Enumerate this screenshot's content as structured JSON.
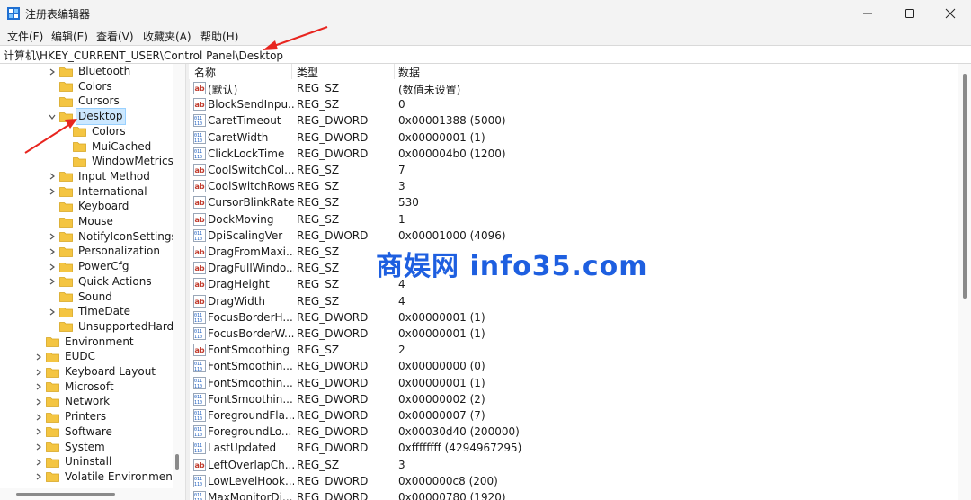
{
  "window": {
    "title": "注册表编辑器",
    "icons": {
      "app": "registry-editor-icon",
      "minimize": "minimize-icon",
      "maximize": "maximize-icon",
      "close": "close-icon"
    }
  },
  "menu": [
    "文件(F)",
    "编辑(E)",
    "查看(V)",
    "收藏夹(A)",
    "帮助(H)"
  ],
  "address": "计算机\\HKEY_CURRENT_USER\\Control Panel\\Desktop",
  "tree": [
    {
      "label": "Bluetooth",
      "level": 2,
      "chevron": "collapsed"
    },
    {
      "label": "Colors",
      "level": 2,
      "chevron": "none"
    },
    {
      "label": "Cursors",
      "level": 2,
      "chevron": "none"
    },
    {
      "label": "Desktop",
      "level": 2,
      "chevron": "expanded",
      "selected": true
    },
    {
      "label": "Colors",
      "level": 3,
      "chevron": "none"
    },
    {
      "label": "MuiCached",
      "level": 3,
      "chevron": "none"
    },
    {
      "label": "WindowMetrics",
      "level": 3,
      "chevron": "none"
    },
    {
      "label": "Input Method",
      "level": 2,
      "chevron": "collapsed"
    },
    {
      "label": "International",
      "level": 2,
      "chevron": "collapsed"
    },
    {
      "label": "Keyboard",
      "level": 2,
      "chevron": "none"
    },
    {
      "label": "Mouse",
      "level": 2,
      "chevron": "none"
    },
    {
      "label": "NotifyIconSettings",
      "level": 2,
      "chevron": "collapsed"
    },
    {
      "label": "Personalization",
      "level": 2,
      "chevron": "collapsed"
    },
    {
      "label": "PowerCfg",
      "level": 2,
      "chevron": "collapsed"
    },
    {
      "label": "Quick Actions",
      "level": 2,
      "chevron": "collapsed"
    },
    {
      "label": "Sound",
      "level": 2,
      "chevron": "none"
    },
    {
      "label": "TimeDate",
      "level": 2,
      "chevron": "collapsed"
    },
    {
      "label": "UnsupportedHardv",
      "level": 2,
      "chevron": "none"
    },
    {
      "label": "Environment",
      "level": 1,
      "chevron": "none"
    },
    {
      "label": "EUDC",
      "level": 1,
      "chevron": "collapsed"
    },
    {
      "label": "Keyboard Layout",
      "level": 1,
      "chevron": "collapsed"
    },
    {
      "label": "Microsoft",
      "level": 1,
      "chevron": "collapsed"
    },
    {
      "label": "Network",
      "level": 1,
      "chevron": "collapsed"
    },
    {
      "label": "Printers",
      "level": 1,
      "chevron": "collapsed"
    },
    {
      "label": "Software",
      "level": 1,
      "chevron": "collapsed"
    },
    {
      "label": "System",
      "level": 1,
      "chevron": "collapsed"
    },
    {
      "label": "Uninstall",
      "level": 1,
      "chevron": "collapsed"
    },
    {
      "label": "Volatile Environment",
      "level": 1,
      "chevron": "collapsed"
    }
  ],
  "list": {
    "headers": {
      "name": "名称",
      "type": "类型",
      "data": "数据"
    },
    "rows": [
      {
        "name": "(默认)",
        "type": "REG_SZ",
        "data": "(数值未设置)",
        "icon": "string-value-icon"
      },
      {
        "name": "BlockSendInpu...",
        "type": "REG_SZ",
        "data": "0",
        "icon": "string-value-icon"
      },
      {
        "name": "CaretTimeout",
        "type": "REG_DWORD",
        "data": "0x00001388 (5000)",
        "icon": "binary-value-icon"
      },
      {
        "name": "CaretWidth",
        "type": "REG_DWORD",
        "data": "0x00000001 (1)",
        "icon": "binary-value-icon"
      },
      {
        "name": "ClickLockTime",
        "type": "REG_DWORD",
        "data": "0x000004b0 (1200)",
        "icon": "binary-value-icon"
      },
      {
        "name": "CoolSwitchCol...",
        "type": "REG_SZ",
        "data": "7",
        "icon": "string-value-icon"
      },
      {
        "name": "CoolSwitchRows",
        "type": "REG_SZ",
        "data": "3",
        "icon": "string-value-icon"
      },
      {
        "name": "CursorBlinkRate",
        "type": "REG_SZ",
        "data": "530",
        "icon": "string-value-icon"
      },
      {
        "name": "DockMoving",
        "type": "REG_SZ",
        "data": "1",
        "icon": "string-value-icon"
      },
      {
        "name": "DpiScalingVer",
        "type": "REG_DWORD",
        "data": "0x00001000 (4096)",
        "icon": "binary-value-icon"
      },
      {
        "name": "DragFromMaxi...",
        "type": "REG_SZ",
        "data": "",
        "icon": "string-value-icon"
      },
      {
        "name": "DragFullWindo...",
        "type": "REG_SZ",
        "data": "",
        "icon": "string-value-icon"
      },
      {
        "name": "DragHeight",
        "type": "REG_SZ",
        "data": "4",
        "icon": "string-value-icon"
      },
      {
        "name": "DragWidth",
        "type": "REG_SZ",
        "data": "4",
        "icon": "string-value-icon"
      },
      {
        "name": "FocusBorderH...",
        "type": "REG_DWORD",
        "data": "0x00000001 (1)",
        "icon": "binary-value-icon"
      },
      {
        "name": "FocusBorderW...",
        "type": "REG_DWORD",
        "data": "0x00000001 (1)",
        "icon": "binary-value-icon"
      },
      {
        "name": "FontSmoothing",
        "type": "REG_SZ",
        "data": "2",
        "icon": "string-value-icon"
      },
      {
        "name": "FontSmoothin...",
        "type": "REG_DWORD",
        "data": "0x00000000 (0)",
        "icon": "binary-value-icon"
      },
      {
        "name": "FontSmoothin...",
        "type": "REG_DWORD",
        "data": "0x00000001 (1)",
        "icon": "binary-value-icon"
      },
      {
        "name": "FontSmoothin...",
        "type": "REG_DWORD",
        "data": "0x00000002 (2)",
        "icon": "binary-value-icon"
      },
      {
        "name": "ForegroundFla...",
        "type": "REG_DWORD",
        "data": "0x00000007 (7)",
        "icon": "binary-value-icon"
      },
      {
        "name": "ForegroundLo...",
        "type": "REG_DWORD",
        "data": "0x00030d40 (200000)",
        "icon": "binary-value-icon"
      },
      {
        "name": "LastUpdated",
        "type": "REG_DWORD",
        "data": "0xffffffff (4294967295)",
        "icon": "binary-value-icon"
      },
      {
        "name": "LeftOverlapCh...",
        "type": "REG_SZ",
        "data": "3",
        "icon": "string-value-icon"
      },
      {
        "name": "LowLevelHook...",
        "type": "REG_DWORD",
        "data": "0x000000c8 (200)",
        "icon": "binary-value-icon"
      },
      {
        "name": "MaxMonitorDi...",
        "type": "REG_DWORD",
        "data": "0x00000780 (1920)",
        "icon": "binary-value-icon"
      }
    ]
  },
  "watermark": "商娱网 info35.com",
  "colors": {
    "annotation_arrow": "#e8251f",
    "watermark": "#1e5fe0",
    "folder": "#f4c542",
    "selection": "#cce8ff"
  }
}
